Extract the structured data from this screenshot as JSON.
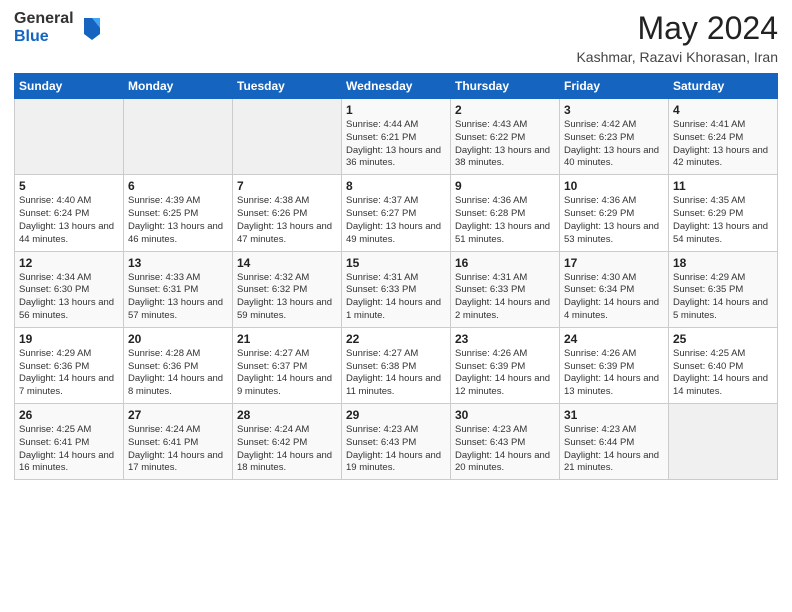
{
  "logo": {
    "general": "General",
    "blue": "Blue"
  },
  "calendar": {
    "title": "May 2024",
    "location": "Kashmar, Razavi Khorasan, Iran",
    "days": [
      "Sunday",
      "Monday",
      "Tuesday",
      "Wednesday",
      "Thursday",
      "Friday",
      "Saturday"
    ],
    "weeks": [
      [
        {
          "day": "",
          "sunrise": "",
          "sunset": "",
          "daylight": ""
        },
        {
          "day": "",
          "sunrise": "",
          "sunset": "",
          "daylight": ""
        },
        {
          "day": "",
          "sunrise": "",
          "sunset": "",
          "daylight": ""
        },
        {
          "day": "1",
          "sunrise": "Sunrise: 4:44 AM",
          "sunset": "Sunset: 6:21 PM",
          "daylight": "Daylight: 13 hours and 36 minutes."
        },
        {
          "day": "2",
          "sunrise": "Sunrise: 4:43 AM",
          "sunset": "Sunset: 6:22 PM",
          "daylight": "Daylight: 13 hours and 38 minutes."
        },
        {
          "day": "3",
          "sunrise": "Sunrise: 4:42 AM",
          "sunset": "Sunset: 6:23 PM",
          "daylight": "Daylight: 13 hours and 40 minutes."
        },
        {
          "day": "4",
          "sunrise": "Sunrise: 4:41 AM",
          "sunset": "Sunset: 6:24 PM",
          "daylight": "Daylight: 13 hours and 42 minutes."
        }
      ],
      [
        {
          "day": "5",
          "sunrise": "Sunrise: 4:40 AM",
          "sunset": "Sunset: 6:24 PM",
          "daylight": "Daylight: 13 hours and 44 minutes."
        },
        {
          "day": "6",
          "sunrise": "Sunrise: 4:39 AM",
          "sunset": "Sunset: 6:25 PM",
          "daylight": "Daylight: 13 hours and 46 minutes."
        },
        {
          "day": "7",
          "sunrise": "Sunrise: 4:38 AM",
          "sunset": "Sunset: 6:26 PM",
          "daylight": "Daylight: 13 hours and 47 minutes."
        },
        {
          "day": "8",
          "sunrise": "Sunrise: 4:37 AM",
          "sunset": "Sunset: 6:27 PM",
          "daylight": "Daylight: 13 hours and 49 minutes."
        },
        {
          "day": "9",
          "sunrise": "Sunrise: 4:36 AM",
          "sunset": "Sunset: 6:28 PM",
          "daylight": "Daylight: 13 hours and 51 minutes."
        },
        {
          "day": "10",
          "sunrise": "Sunrise: 4:36 AM",
          "sunset": "Sunset: 6:29 PM",
          "daylight": "Daylight: 13 hours and 53 minutes."
        },
        {
          "day": "11",
          "sunrise": "Sunrise: 4:35 AM",
          "sunset": "Sunset: 6:29 PM",
          "daylight": "Daylight: 13 hours and 54 minutes."
        }
      ],
      [
        {
          "day": "12",
          "sunrise": "Sunrise: 4:34 AM",
          "sunset": "Sunset: 6:30 PM",
          "daylight": "Daylight: 13 hours and 56 minutes."
        },
        {
          "day": "13",
          "sunrise": "Sunrise: 4:33 AM",
          "sunset": "Sunset: 6:31 PM",
          "daylight": "Daylight: 13 hours and 57 minutes."
        },
        {
          "day": "14",
          "sunrise": "Sunrise: 4:32 AM",
          "sunset": "Sunset: 6:32 PM",
          "daylight": "Daylight: 13 hours and 59 minutes."
        },
        {
          "day": "15",
          "sunrise": "Sunrise: 4:31 AM",
          "sunset": "Sunset: 6:33 PM",
          "daylight": "Daylight: 14 hours and 1 minute."
        },
        {
          "day": "16",
          "sunrise": "Sunrise: 4:31 AM",
          "sunset": "Sunset: 6:33 PM",
          "daylight": "Daylight: 14 hours and 2 minutes."
        },
        {
          "day": "17",
          "sunrise": "Sunrise: 4:30 AM",
          "sunset": "Sunset: 6:34 PM",
          "daylight": "Daylight: 14 hours and 4 minutes."
        },
        {
          "day": "18",
          "sunrise": "Sunrise: 4:29 AM",
          "sunset": "Sunset: 6:35 PM",
          "daylight": "Daylight: 14 hours and 5 minutes."
        }
      ],
      [
        {
          "day": "19",
          "sunrise": "Sunrise: 4:29 AM",
          "sunset": "Sunset: 6:36 PM",
          "daylight": "Daylight: 14 hours and 7 minutes."
        },
        {
          "day": "20",
          "sunrise": "Sunrise: 4:28 AM",
          "sunset": "Sunset: 6:36 PM",
          "daylight": "Daylight: 14 hours and 8 minutes."
        },
        {
          "day": "21",
          "sunrise": "Sunrise: 4:27 AM",
          "sunset": "Sunset: 6:37 PM",
          "daylight": "Daylight: 14 hours and 9 minutes."
        },
        {
          "day": "22",
          "sunrise": "Sunrise: 4:27 AM",
          "sunset": "Sunset: 6:38 PM",
          "daylight": "Daylight: 14 hours and 11 minutes."
        },
        {
          "day": "23",
          "sunrise": "Sunrise: 4:26 AM",
          "sunset": "Sunset: 6:39 PM",
          "daylight": "Daylight: 14 hours and 12 minutes."
        },
        {
          "day": "24",
          "sunrise": "Sunrise: 4:26 AM",
          "sunset": "Sunset: 6:39 PM",
          "daylight": "Daylight: 14 hours and 13 minutes."
        },
        {
          "day": "25",
          "sunrise": "Sunrise: 4:25 AM",
          "sunset": "Sunset: 6:40 PM",
          "daylight": "Daylight: 14 hours and 14 minutes."
        }
      ],
      [
        {
          "day": "26",
          "sunrise": "Sunrise: 4:25 AM",
          "sunset": "Sunset: 6:41 PM",
          "daylight": "Daylight: 14 hours and 16 minutes."
        },
        {
          "day": "27",
          "sunrise": "Sunrise: 4:24 AM",
          "sunset": "Sunset: 6:41 PM",
          "daylight": "Daylight: 14 hours and 17 minutes."
        },
        {
          "day": "28",
          "sunrise": "Sunrise: 4:24 AM",
          "sunset": "Sunset: 6:42 PM",
          "daylight": "Daylight: 14 hours and 18 minutes."
        },
        {
          "day": "29",
          "sunrise": "Sunrise: 4:23 AM",
          "sunset": "Sunset: 6:43 PM",
          "daylight": "Daylight: 14 hours and 19 minutes."
        },
        {
          "day": "30",
          "sunrise": "Sunrise: 4:23 AM",
          "sunset": "Sunset: 6:43 PM",
          "daylight": "Daylight: 14 hours and 20 minutes."
        },
        {
          "day": "31",
          "sunrise": "Sunrise: 4:23 AM",
          "sunset": "Sunset: 6:44 PM",
          "daylight": "Daylight: 14 hours and 21 minutes."
        },
        {
          "day": "",
          "sunrise": "",
          "sunset": "",
          "daylight": ""
        }
      ]
    ]
  }
}
